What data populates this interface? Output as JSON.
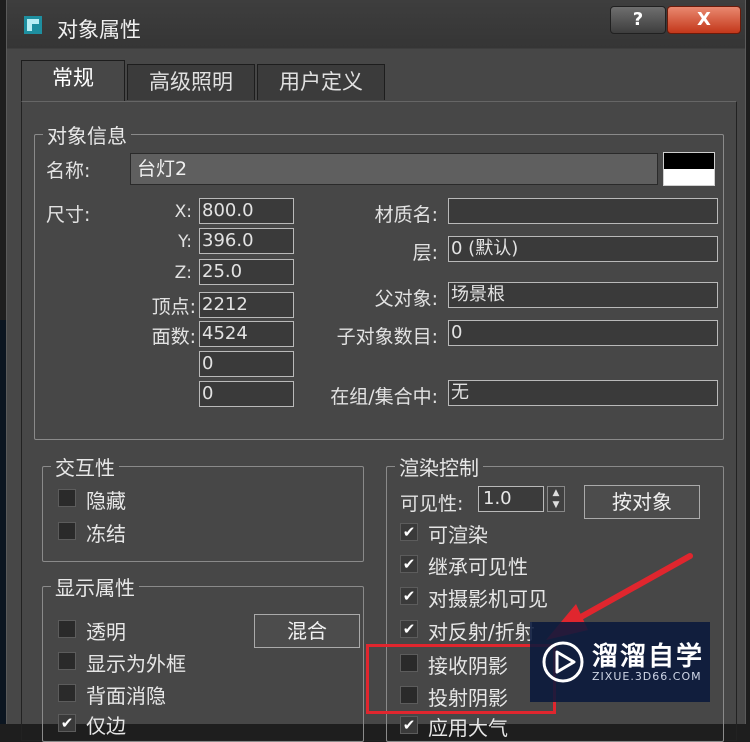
{
  "window": {
    "title": "对象属性",
    "help_label": "?",
    "close_label": "X"
  },
  "tabs": [
    {
      "label": "常规",
      "active": true
    },
    {
      "label": "高级照明",
      "active": false
    },
    {
      "label": "用户定义",
      "active": false
    }
  ],
  "object_info": {
    "legend": "对象信息",
    "name_label": "名称:",
    "name_value": "台灯2",
    "color_swatch": [
      "#000000",
      "#ffffff"
    ],
    "size_label": "尺寸:",
    "x_label": "X:",
    "x_value": "800.0",
    "y_label": "Y:",
    "y_value": "396.0",
    "z_label": "Z:",
    "z_value": "25.0",
    "vertices_label": "顶点:",
    "vertices_value": "2212",
    "faces_label": "面数:",
    "faces_value": "4524",
    "extra1_value": "0",
    "extra2_value": "0",
    "material_label": "材质名:",
    "material_value": "",
    "layer_label": "层:",
    "layer_value": "0 (默认)",
    "parent_label": "父对象:",
    "parent_value": "场景根",
    "children_label": "子对象数目:",
    "children_value": "0",
    "group_label": "在组/集合中:",
    "group_value": "无"
  },
  "interactivity": {
    "legend": "交互性",
    "hide": {
      "label": "隐藏",
      "checked": false
    },
    "freeze": {
      "label": "冻结",
      "checked": false
    }
  },
  "display": {
    "legend": "显示属性",
    "transparent": {
      "label": "透明",
      "checked": false
    },
    "box": {
      "label": "显示为外框",
      "checked": false
    },
    "backface": {
      "label": "背面消隐",
      "checked": false
    },
    "edges_only": {
      "label": "仅边",
      "checked": true
    },
    "blend_button": "混合"
  },
  "render": {
    "legend": "渲染控制",
    "visibility_label": "可见性:",
    "visibility_value": "1.0",
    "by_object_button": "按对象",
    "renderable": {
      "label": "可渲染",
      "checked": true
    },
    "inherit": {
      "label": "继承可见性",
      "checked": true
    },
    "camera": {
      "label": "对摄影机可见",
      "checked": true
    },
    "reflection": {
      "label": "对反射/折射",
      "checked": true
    },
    "receive_shadows": {
      "label": "接收阴影",
      "checked": false
    },
    "cast_shadows": {
      "label": "投射阴影",
      "checked": false
    },
    "atmosphere": {
      "label": "应用大气",
      "checked": true
    }
  },
  "annotation": {
    "highlight_color": "#e0262e"
  },
  "watermark": {
    "brand": "溜溜自学",
    "url": "ZIXUE.3D66.COM"
  }
}
